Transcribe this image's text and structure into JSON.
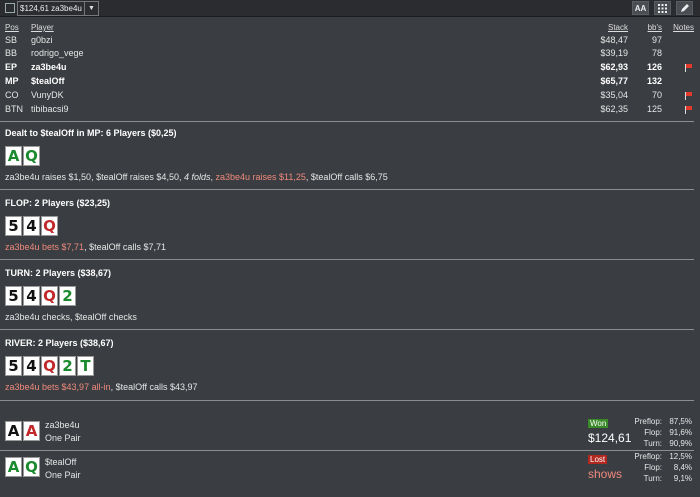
{
  "toolbar": {
    "hand_value": "$124,61 za3be4u",
    "dropdown_arrow": "▼",
    "font_button": "AA",
    "grid_icon": "grid-icon",
    "pencil_icon": "pencil-icon"
  },
  "table": {
    "headers": {
      "pos": "Pos",
      "player": "Player",
      "stack": "Stack",
      "bbs": "bb's",
      "notes": "Notes"
    },
    "rows": [
      {
        "pos": "SB",
        "player": "g0bzi",
        "stack": "$48,47",
        "bbs": "97",
        "bold": false,
        "flag": false
      },
      {
        "pos": "BB",
        "player": "rodrigo_vege",
        "stack": "$39,19",
        "bbs": "78",
        "bold": false,
        "flag": false
      },
      {
        "pos": "EP",
        "player": "za3be4u",
        "stack": "$62,93",
        "bbs": "126",
        "bold": true,
        "flag": true
      },
      {
        "pos": "MP",
        "player": "$tealOff",
        "stack": "$65,77",
        "bbs": "132",
        "bold": true,
        "flag": false
      },
      {
        "pos": "CO",
        "player": "VunyDK",
        "stack": "$35,04",
        "bbs": "70",
        "bold": false,
        "flag": true
      },
      {
        "pos": "BTN",
        "player": "tibibacsi9",
        "stack": "$62,35",
        "bbs": "125",
        "bold": false,
        "flag": true
      }
    ]
  },
  "preflop": {
    "title": "Dealt to $tealOff in MP: 6 Players ($0,25)",
    "cards": [
      {
        "rank": "A",
        "suit": "green"
      },
      {
        "rank": "Q",
        "suit": "green"
      }
    ],
    "action": {
      "p1": "za3be4u raises $1,50, $tealOff raises $4,50, ",
      "p2": "4 folds",
      "p3": ", ",
      "p4": "za3be4u raises $11,25",
      "p5": ", $tealOff calls $6,75"
    }
  },
  "flop": {
    "title": "FLOP: 2 Players ($23,25)",
    "cards": [
      {
        "rank": "5",
        "suit": "black"
      },
      {
        "rank": "4",
        "suit": "black"
      },
      {
        "rank": "Q",
        "suit": "red"
      }
    ],
    "action": {
      "p1": "za3be4u bets $7,71",
      "p2": ", $tealOff calls $7,71"
    }
  },
  "turn": {
    "title": "TURN: 2 Players ($38,67)",
    "cards": [
      {
        "rank": "5",
        "suit": "black"
      },
      {
        "rank": "4",
        "suit": "black"
      },
      {
        "rank": "Q",
        "suit": "red"
      },
      {
        "rank": "2",
        "suit": "green"
      }
    ],
    "action": "za3be4u checks, $tealOff checks"
  },
  "river": {
    "title": "RIVER: 2 Players ($38,67)",
    "cards": [
      {
        "rank": "5",
        "suit": "black"
      },
      {
        "rank": "4",
        "suit": "black"
      },
      {
        "rank": "Q",
        "suit": "red"
      },
      {
        "rank": "2",
        "suit": "green"
      },
      {
        "rank": "T",
        "suit": "green"
      }
    ],
    "action": {
      "p1": "za3be4u bets $43,97 all-in",
      "p2": ", $tealOff calls $43,97"
    }
  },
  "showdown": [
    {
      "player": "za3be4u",
      "hand": "One Pair",
      "cards": [
        {
          "rank": "A",
          "suit": "black"
        },
        {
          "rank": "A",
          "suit": "red"
        }
      ],
      "result": "Won",
      "amount": "$124,61",
      "equity": [
        {
          "label": "Preflop:",
          "value": "87,5%"
        },
        {
          "label": "Flop:",
          "value": "91,6%"
        },
        {
          "label": "Turn:",
          "value": "90,9%"
        }
      ]
    },
    {
      "player": "$tealOff",
      "hand": "One Pair",
      "cards": [
        {
          "rank": "A",
          "suit": "green"
        },
        {
          "rank": "Q",
          "suit": "green"
        }
      ],
      "result": "Lost",
      "amount": "shows",
      "equity": [
        {
          "label": "Preflop:",
          "value": "12,5%"
        },
        {
          "label": "Flop:",
          "value": "8,4%"
        },
        {
          "label": "Turn:",
          "value": "9,1%"
        }
      ]
    }
  ]
}
